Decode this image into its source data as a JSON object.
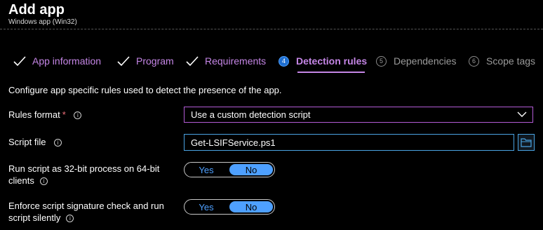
{
  "header": {
    "title": "Add app",
    "subtitle": "Windows app (Win32)"
  },
  "wizard": {
    "steps": [
      {
        "label": "App information",
        "state": "done"
      },
      {
        "label": "Program",
        "state": "done"
      },
      {
        "label": "Requirements",
        "state": "done"
      },
      {
        "label": "Detection rules",
        "state": "active",
        "number": "4"
      },
      {
        "label": "Dependencies",
        "state": "pending",
        "number": "5"
      },
      {
        "label": "Scope tags",
        "state": "pending",
        "number": "6"
      }
    ]
  },
  "form": {
    "description": "Configure app specific rules used to detect the presence of the app.",
    "rules_format": {
      "label": "Rules format",
      "required_mark": "*",
      "value": "Use a custom detection script"
    },
    "script_file": {
      "label": "Script file",
      "value": "Get-LSIFService.ps1"
    },
    "run_32bit": {
      "label_line1": "Run script as 32-bit process on 64-bit",
      "label_line2": "clients",
      "yes": "Yes",
      "no": "No",
      "selected": "No"
    },
    "enforce_signature": {
      "label_line1": "Enforce script signature check and run",
      "label_line2": "script silently",
      "yes": "Yes",
      "no": "No",
      "selected": "No"
    }
  },
  "icons": {
    "info": "info-icon",
    "check": "checkmark-icon",
    "chevron": "chevron-down-icon",
    "browse": "folder-icon"
  },
  "colors": {
    "accent_purple": "#c586e6",
    "accent_blue": "#4ea0ff",
    "background": "#000000"
  }
}
